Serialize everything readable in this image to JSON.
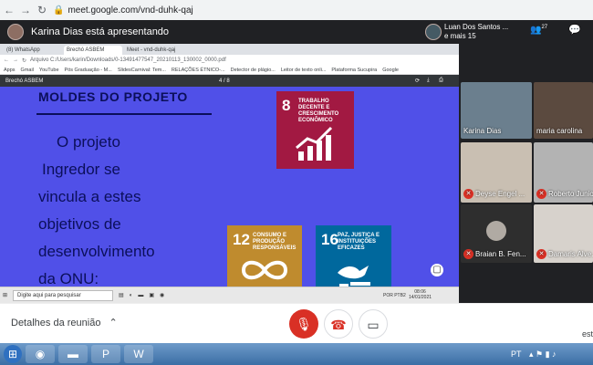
{
  "browser": {
    "url": "meet.google.com/vnd-duhk-qaj"
  },
  "meet_header": {
    "presenter_text": "Karina Dias está apresentando",
    "others_name": "Luan Dos Santos ...",
    "others_more": "e mais 15",
    "people_count": "27"
  },
  "shared": {
    "tabs": [
      "(8) WhatsApp",
      "Brechó ASBEM",
      "Meet - vnd-duhk-qaj"
    ],
    "address": "Arquivo  C:/Users/karin/Downloads/0-13491477547_20210113_130002_0000.pdf",
    "bookmarks": [
      "Apps",
      "Gmail",
      "YouTube",
      "Pós Graduação - M...",
      "SlidesCarnival: Tem...",
      "RELAÇÕES ÉTNICO-...",
      "Detector de plágio...",
      "Leitor de texto onli...",
      "Plataforma Sucupira",
      "Google"
    ],
    "pdf_title": "Brechó ASBEM",
    "pdf_page": "4 / 8",
    "slide_title": "MOLDES DO PROJETO",
    "slide_body": [
      "O projeto",
      "Ingredor se",
      "vincula a estes",
      "objetivos de",
      "desenvolvimento",
      "da ONU:"
    ],
    "sdg8": {
      "num": "8",
      "text": "TRABALHO DECENTE E CRESCIMENTO ECONÔMICO",
      "color": "#a21942"
    },
    "sdg12": {
      "num": "12",
      "text": "CONSUMO E PRODUÇÃO RESPONSÁVEIS",
      "color": "#bf8b2e"
    },
    "sdg16": {
      "num": "16",
      "text": "PAZ, JUSTIÇA E INSTITUIÇÕES EFICAZES",
      "color": "#00689d"
    },
    "search_placeholder": "Digite aqui para pesquisar",
    "tray_lang": "POR PTB2",
    "tray_time": "08:06",
    "tray_date": "14/01/2021"
  },
  "participants": [
    {
      "name": "Karina Dias",
      "muted": false
    },
    {
      "name": "maria carolina",
      "muted": false
    },
    {
      "name": "Deyse Engel ...",
      "muted": true
    },
    {
      "name": "Roberto Junior",
      "muted": true
    },
    {
      "name": "Braian B. Fen...",
      "muted": true
    },
    {
      "name": "Damaris Alve...",
      "muted": true
    }
  ],
  "meetbar": {
    "details_label": "Detalhes da reunião",
    "right_text": "est"
  },
  "taskbar": {
    "tray_lang": "PT"
  }
}
